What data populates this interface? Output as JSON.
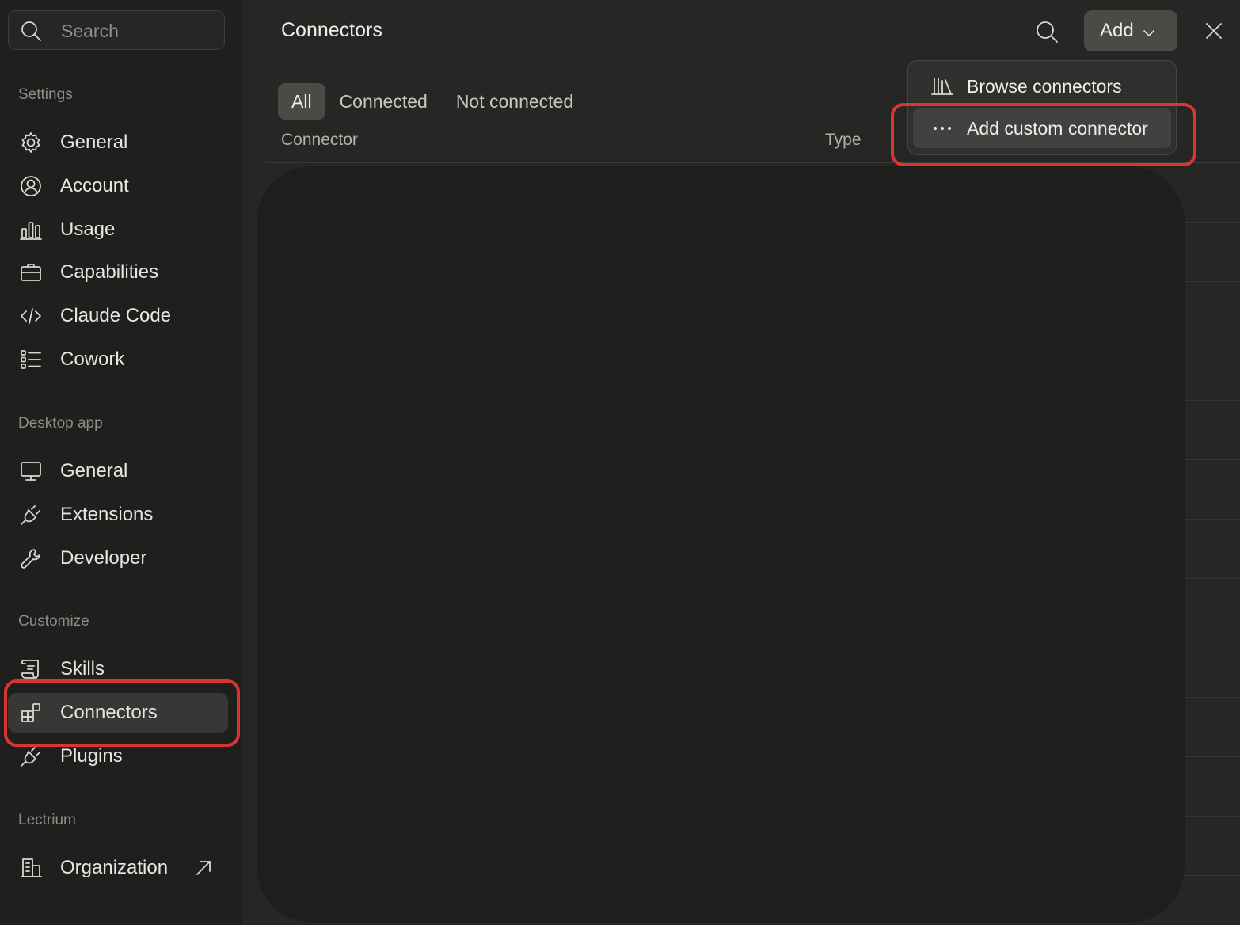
{
  "sidebar": {
    "search_placeholder": "Search",
    "sections": {
      "settings": "Settings",
      "desktop_app": "Desktop app",
      "customize": "Customize",
      "org": "Lectrium"
    },
    "items": {
      "general": "General",
      "account": "Account",
      "usage": "Usage",
      "capabilities": "Capabilities",
      "claude_code": "Claude Code",
      "cowork": "Cowork",
      "desktop_general": "General",
      "extensions": "Extensions",
      "developer": "Developer",
      "skills": "Skills",
      "connectors": "Connectors",
      "plugins": "Plugins",
      "organization": "Organization"
    },
    "active_item": "connectors"
  },
  "header": {
    "title": "Connectors",
    "add_label": "Add"
  },
  "tabs": {
    "all": "All",
    "connected": "Connected",
    "not_connected": "Not connected",
    "active": "all"
  },
  "table": {
    "col_connector": "Connector",
    "col_type": "Type"
  },
  "add_menu": {
    "browse": "Browse connectors",
    "custom": "Add custom connector"
  },
  "colors": {
    "annotation": "#d93535",
    "sidebar_bg": "#1f1f1e",
    "main_bg": "#262625"
  }
}
